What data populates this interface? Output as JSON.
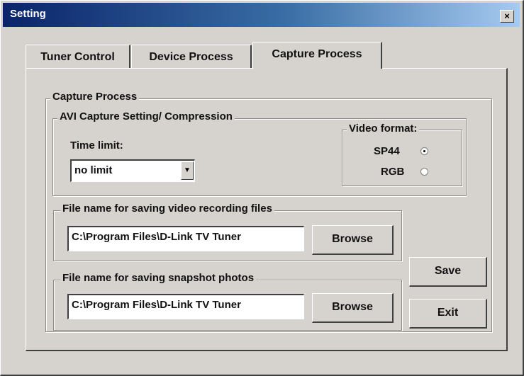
{
  "window": {
    "title": "Setting",
    "close_label": "×"
  },
  "tabs": [
    {
      "label": "Tuner Control",
      "active": false
    },
    {
      "label": "Device Process",
      "active": false
    },
    {
      "label": "Capture Process",
      "active": true
    }
  ],
  "capture_process": {
    "group_label": "Capture Process",
    "avi": {
      "group_label": "AVI Capture Setting/ Compression",
      "time_limit_label": "Time limit:",
      "time_limit_value": "no limit",
      "video_format": {
        "group_label": "Video format:",
        "options": [
          {
            "label": "SP44",
            "selected": true
          },
          {
            "label": "RGB",
            "selected": false
          }
        ]
      }
    },
    "video_files": {
      "group_label": "File name for saving video recording files",
      "path": "C:\\Program Files\\D-Link TV Tuner",
      "browse_label": "Browse"
    },
    "snapshot_files": {
      "group_label": "File name for saving snapshot photos",
      "path": "C:\\Program Files\\D-Link TV Tuner",
      "browse_label": "Browse"
    }
  },
  "buttons": {
    "save_label": "Save",
    "exit_label": "Exit"
  }
}
